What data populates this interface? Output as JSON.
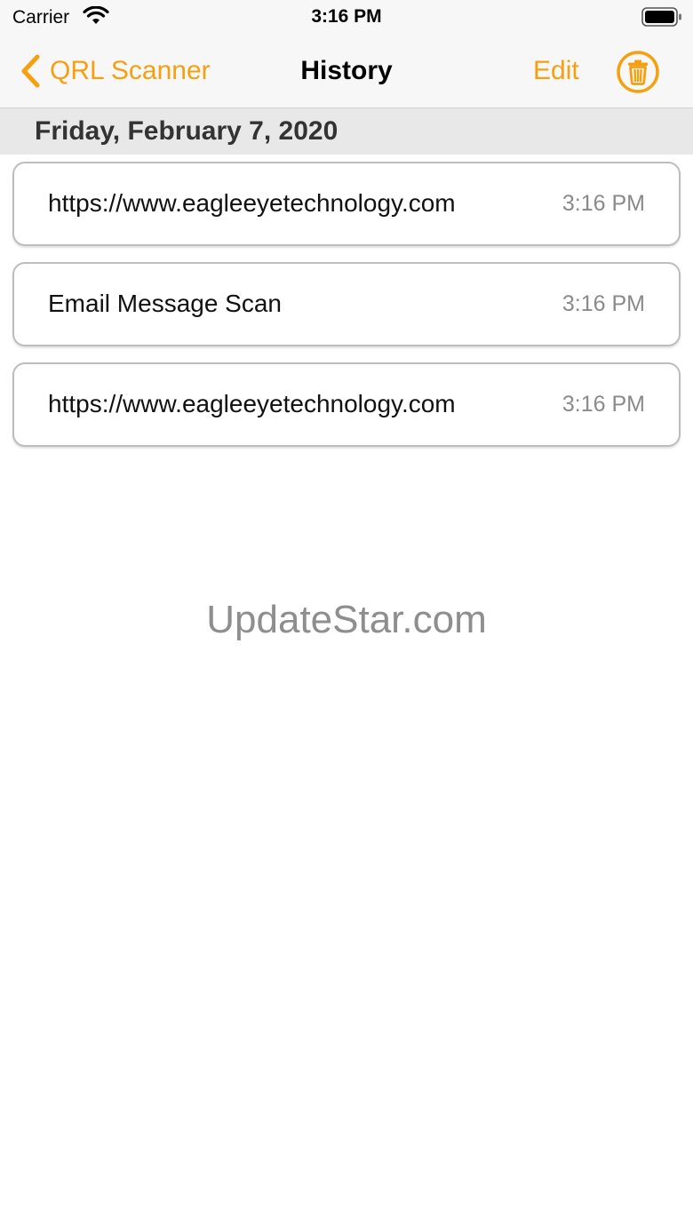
{
  "status_bar": {
    "carrier": "Carrier",
    "time": "3:16 PM",
    "wifi_icon": "wifi-icon",
    "battery_icon": "battery-icon"
  },
  "nav": {
    "back_label": "QRL Scanner",
    "back_icon": "chevron-left-icon",
    "title": "History",
    "edit_label": "Edit",
    "trash_icon": "trash-icon",
    "accent_color": "#f4a011"
  },
  "section": {
    "title": "Friday, February 7, 2020"
  },
  "history": {
    "items": [
      {
        "title": "https://www.eagleeyetechnology.com",
        "time": "3:16 PM"
      },
      {
        "title": "Email Message Scan",
        "time": "3:16 PM"
      },
      {
        "title": "https://www.eagleeyetechnology.com",
        "time": "3:16 PM"
      }
    ]
  },
  "watermark": {
    "text": "UpdateStar.com"
  }
}
